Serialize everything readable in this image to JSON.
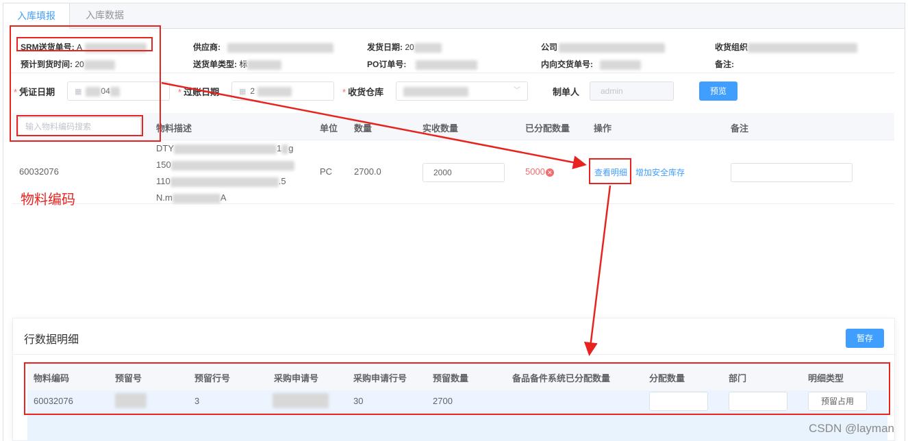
{
  "tabs": [
    {
      "label": "入库填报",
      "active": true
    },
    {
      "label": "入库数据",
      "active": false
    }
  ],
  "info": {
    "srm_label": "SRM送货单号:",
    "srm_value": "A",
    "supplier_label": "供应商:",
    "ship_date_label": "发货日期:",
    "ship_date_value": "20",
    "company_label": "公司",
    "receive_org_label": "收货组织",
    "expected_label": "预计到货时间:",
    "expected_value": "20",
    "delivery_type_label": "送货单类型:",
    "delivery_type_value": "标",
    "po_label": "PO订单号:",
    "inner_label": "内向交货单号:",
    "remark_label": "备注:"
  },
  "form": {
    "voucher_date_label": "凭证日期",
    "voucher_date_value": "04",
    "post_date_label": "过账日期",
    "post_date_value": "2",
    "warehouse_label": "收货仓库",
    "creator_label": "制单人",
    "creator_value": "admin",
    "preview_button": "预览"
  },
  "table1": {
    "search_placeholder": "输入物料编码搜索",
    "headers": {
      "desc": "物料描述",
      "unit": "单位",
      "qty": "数量",
      "received": "实收数量",
      "allocated": "已分配数量",
      "action": "操作",
      "remark": "备注"
    },
    "row": {
      "material_code": "60032076",
      "desc_lines": [
        "DTY",
        "150",
        "110",
        "N.m"
      ],
      "desc_tails": [
        "1",
        "g",
        ".5",
        "A"
      ],
      "unit": "PC",
      "qty": "2700.0",
      "received": "2000",
      "allocated": "5000",
      "view_detail": "查看明细",
      "add_safety_stock": "增加安全库存"
    }
  },
  "annotation_label": "物料编码",
  "detail": {
    "title": "行数据明细",
    "save_button": "暂存",
    "headers": [
      "物料编码",
      "预留号",
      "预留行号",
      "采购申请号",
      "采购申请行号",
      "预留数量",
      "备品备件系统已分配数量",
      "分配数量",
      "部门",
      "明细类型"
    ],
    "row": {
      "material_code": "60032076",
      "reserve_line": "3",
      "pr_line": "30",
      "reserve_qty": "2700",
      "detail_type": "预留占用"
    }
  },
  "watermark": "CSDN @layman",
  "colors": {
    "primary": "#409eff",
    "annotation": "#e8231f",
    "danger": "#f56c6c"
  }
}
